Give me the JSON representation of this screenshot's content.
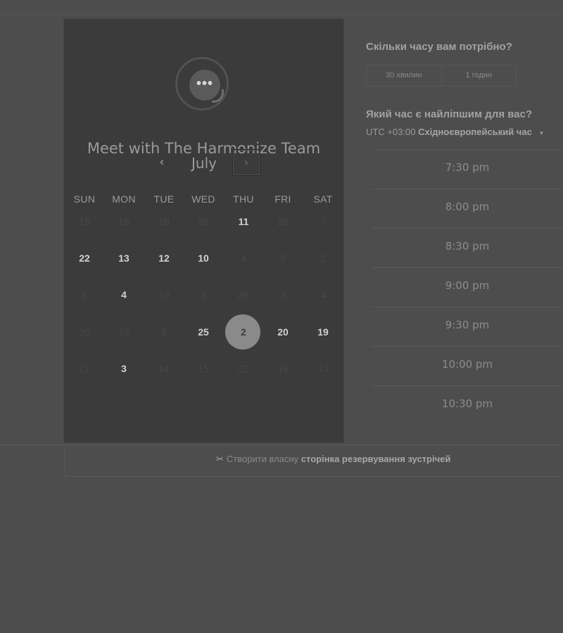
{
  "calendar": {
    "title": "Meet with The Harmonize Team",
    "month": "July",
    "prev_icon": "‹",
    "next_icon": "›",
    "logo_dots": "•••",
    "weekdays": [
      "SUN",
      "MON",
      "TUE",
      "WED",
      "THU",
      "FRI",
      "SAT"
    ],
    "rows": [
      [
        {
          "d": "15",
          "s": "disabled"
        },
        {
          "d": "16",
          "s": "disabled"
        },
        {
          "d": "10",
          "s": "disabled"
        },
        {
          "d": "20",
          "s": "disabled"
        },
        {
          "d": "11",
          "s": "available"
        },
        {
          "d": "26",
          "s": "disabled"
        },
        {
          "d": "7",
          "s": "disabled"
        }
      ],
      [
        {
          "d": "22",
          "s": "available"
        },
        {
          "d": "13",
          "s": "available"
        },
        {
          "d": "12",
          "s": "available"
        },
        {
          "d": "10",
          "s": "available"
        },
        {
          "d": "4",
          "s": "disabled"
        },
        {
          "d": "5",
          "s": "disabled"
        },
        {
          "d": "2",
          "s": "disabled"
        }
      ],
      [
        {
          "d": "6",
          "s": "disabled"
        },
        {
          "d": "4",
          "s": "available"
        },
        {
          "d": "19",
          "s": "disabled"
        },
        {
          "d": "3",
          "s": "disabled"
        },
        {
          "d": "28",
          "s": "disabled"
        },
        {
          "d": "3",
          "s": "disabled"
        },
        {
          "d": "4",
          "s": "disabled"
        }
      ],
      [
        {
          "d": "26",
          "s": "disabled"
        },
        {
          "d": "19",
          "s": "disabled"
        },
        {
          "d": "8",
          "s": "disabled"
        },
        {
          "d": "25",
          "s": "available"
        },
        {
          "d": "2",
          "s": "selected"
        },
        {
          "d": "20",
          "s": "available"
        },
        {
          "d": "19",
          "s": "available"
        }
      ],
      [
        {
          "d": "21",
          "s": "disabled"
        },
        {
          "d": "3",
          "s": "available"
        },
        {
          "d": "14",
          "s": "disabled"
        },
        {
          "d": "15",
          "s": "disabled"
        },
        {
          "d": "22",
          "s": "disabled"
        },
        {
          "d": "19",
          "s": "disabled"
        },
        {
          "d": "13",
          "s": "disabled"
        }
      ]
    ]
  },
  "booking": {
    "duration_question": "Скільки часу вам потрібно?",
    "durations": [
      "30 хвилин",
      "1 годин"
    ],
    "time_question": "Який час є найліпшим для вас?",
    "timezone_offset": "UTC +03:00",
    "timezone_name": "Східноєвропейський час",
    "timezone_caret": "▼",
    "slots": [
      "7:30 pm",
      "8:00 pm",
      "8:30 pm",
      "9:00 pm",
      "9:30 pm",
      "10:00 pm",
      "10:30 pm"
    ]
  },
  "footer": {
    "icon": "✂",
    "text": "Створити власну",
    "link": "сторінка резервування зустрічей"
  }
}
